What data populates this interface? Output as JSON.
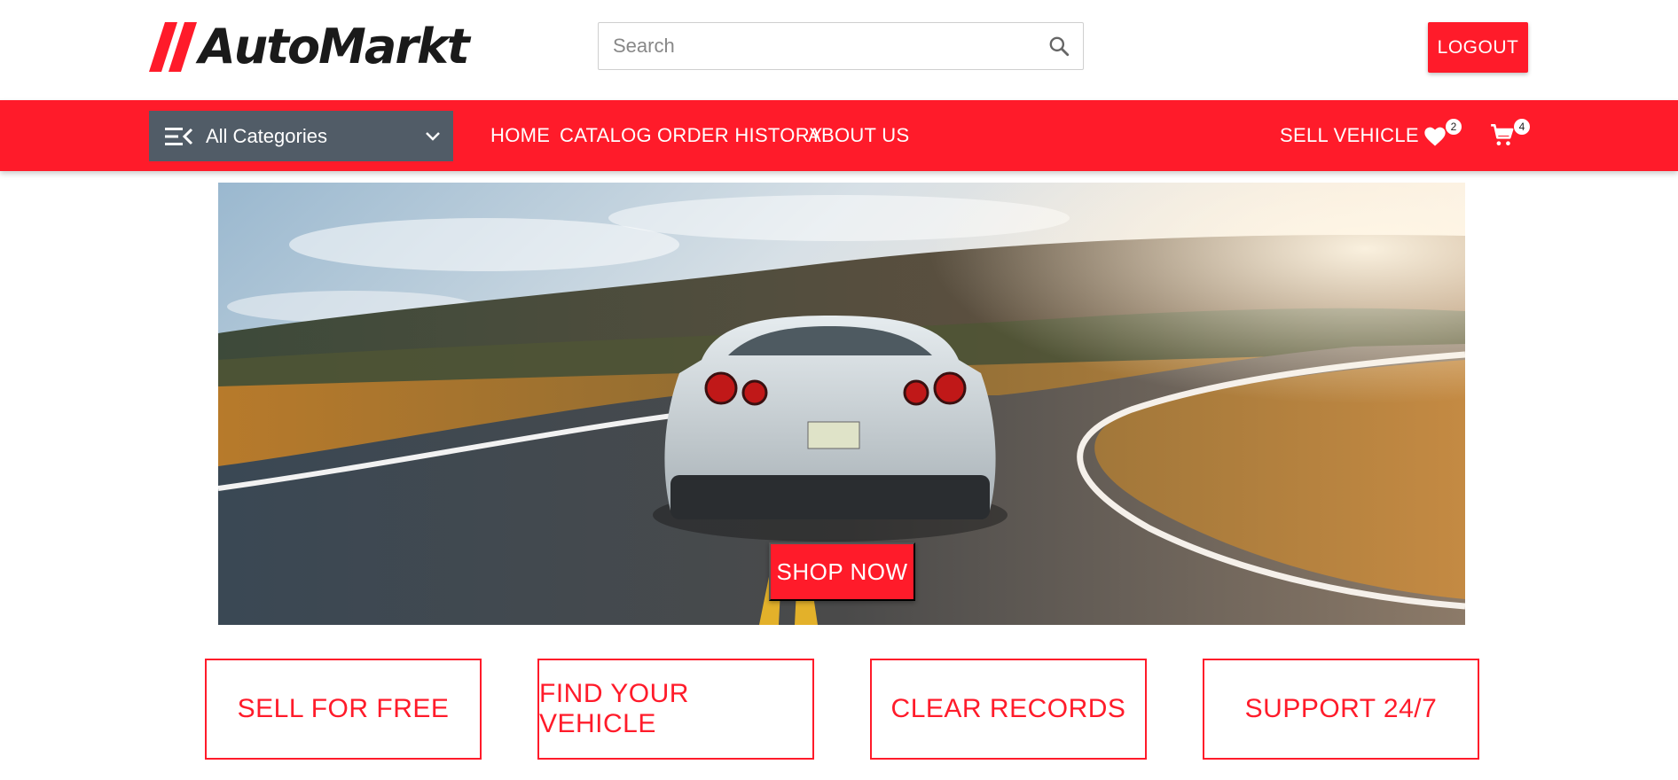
{
  "brand": {
    "name": "AutoMarkt",
    "accent": "#ff1b2a",
    "dark": "#1a1a1a"
  },
  "header": {
    "search": {
      "placeholder": "Search",
      "value": "",
      "icon": "search-icon"
    },
    "logout_label": "LOGOUT"
  },
  "navbar": {
    "categories_label": "All Categories",
    "links": [
      "HOME",
      "CATALOG",
      "ORDER HISTORY",
      "ABOUT US"
    ],
    "sell_label": "SELL VEHICLE",
    "wishlist_count": "2",
    "cart_count": "4",
    "bg": "#ff1b2a",
    "categories_bg": "#515c67"
  },
  "hero": {
    "cta_label": "SHOP NOW"
  },
  "features": [
    "SELL FOR FREE",
    "FIND YOUR VEHICLE",
    "CLEAR RECORDS",
    "SUPPORT 24/7"
  ]
}
